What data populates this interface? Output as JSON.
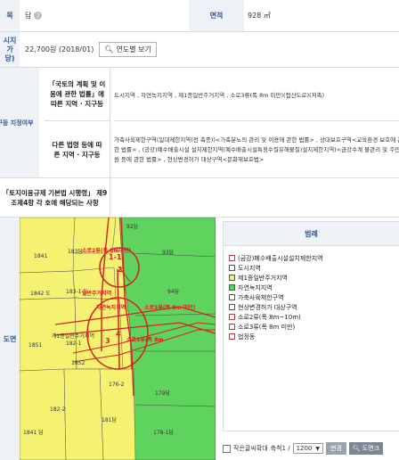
{
  "rows": {
    "land": {
      "label": "목",
      "value": "답",
      "area_label": "면적",
      "area_value": "928 ㎡"
    },
    "price": {
      "label": "시지가\n당)",
      "value": "22,700원 (2018/01)",
      "button": "연도별 보기"
    },
    "zoning": {
      "label": "지구등 지정여부",
      "sub1_label": "「국토의 계획 및 이용에 관한 법률」에 따른 지역 · 지구등",
      "sub1_value": "도시지역 , 자연녹지지역 , 제1종일반주거지역 , 소로3류(폭 8m 미만)(접산도로)(저촉)",
      "sub2_label": "다른 법령 등에 따른 지역 · 지구등",
      "sub2_value": "가축사육제한구역(일대제한지역(전 축종))<가축분뇨의 관리 및 이용에 관한 법률> , 상대보호구역<교육환경 보호에 관한 법률> , (공강)폐수배출시설 설치제한지역(폐수배출시설특정수질유해물질)설치제한지역)<금강수계 물관리 및 주민지원 등에 관한 법률> , 현상변경허가 대상구역<문화재보호법>"
    },
    "enforcement": {
      "label": "「토지이용규제 기본법 시행령」 제9조제4항 각 호에 해당되는 사항",
      "value": ""
    },
    "map": {
      "label": "도면"
    }
  },
  "map": {
    "parcels": [
      "92답",
      "1841",
      "183답",
      "소로2류(폭 8m미만)",
      "93답",
      "94답",
      "1842 도",
      "183-1 도",
      "일반주거지역",
      "자연녹지지역",
      "소로3류(폭 8m 미만)",
      "1851",
      "계1종일반주거지역",
      "182-1",
      "1852",
      "소로3류(폭 8m",
      "176-2",
      "182-2",
      "179답",
      "1-1",
      "2",
      "3",
      "4",
      "181답",
      "178-1답",
      "1841 답"
    ]
  },
  "legend": {
    "title": "범례",
    "items": [
      {
        "label": "(금강)폐수배출시설설치제한지역",
        "color": "#cc3333",
        "fill": "#ffffff"
      },
      {
        "label": "도시지역",
        "color": "#555555",
        "fill": "#ffffff"
      },
      {
        "label": "제1종일반주거지역",
        "color": "#555555",
        "fill": "#f5f07a"
      },
      {
        "label": "자연녹지지역",
        "color": "#555555",
        "fill": "#5fd35f"
      },
      {
        "label": "가축사육제한구역",
        "color": "#555555",
        "fill": "#ffffff"
      },
      {
        "label": "현상변경허가 대상구역",
        "color": "#555555",
        "fill": "#ffffff"
      },
      {
        "label": "소로2류(폭 8m~10m)",
        "color": "#cc3333",
        "fill": "#ffffff"
      },
      {
        "label": "소로3류(폭 8m 미만)",
        "color": "#cc3333",
        "fill": "#ffffff"
      },
      {
        "label": "법정동",
        "color": "#cc3333",
        "fill": "#ffffff"
      }
    ]
  },
  "controls": {
    "zoom_checkbox_label": "작은글씨확대",
    "scale_label": "축척1 /",
    "scale_value": "1200",
    "change_button": "변경",
    "print_button": "도면크"
  }
}
